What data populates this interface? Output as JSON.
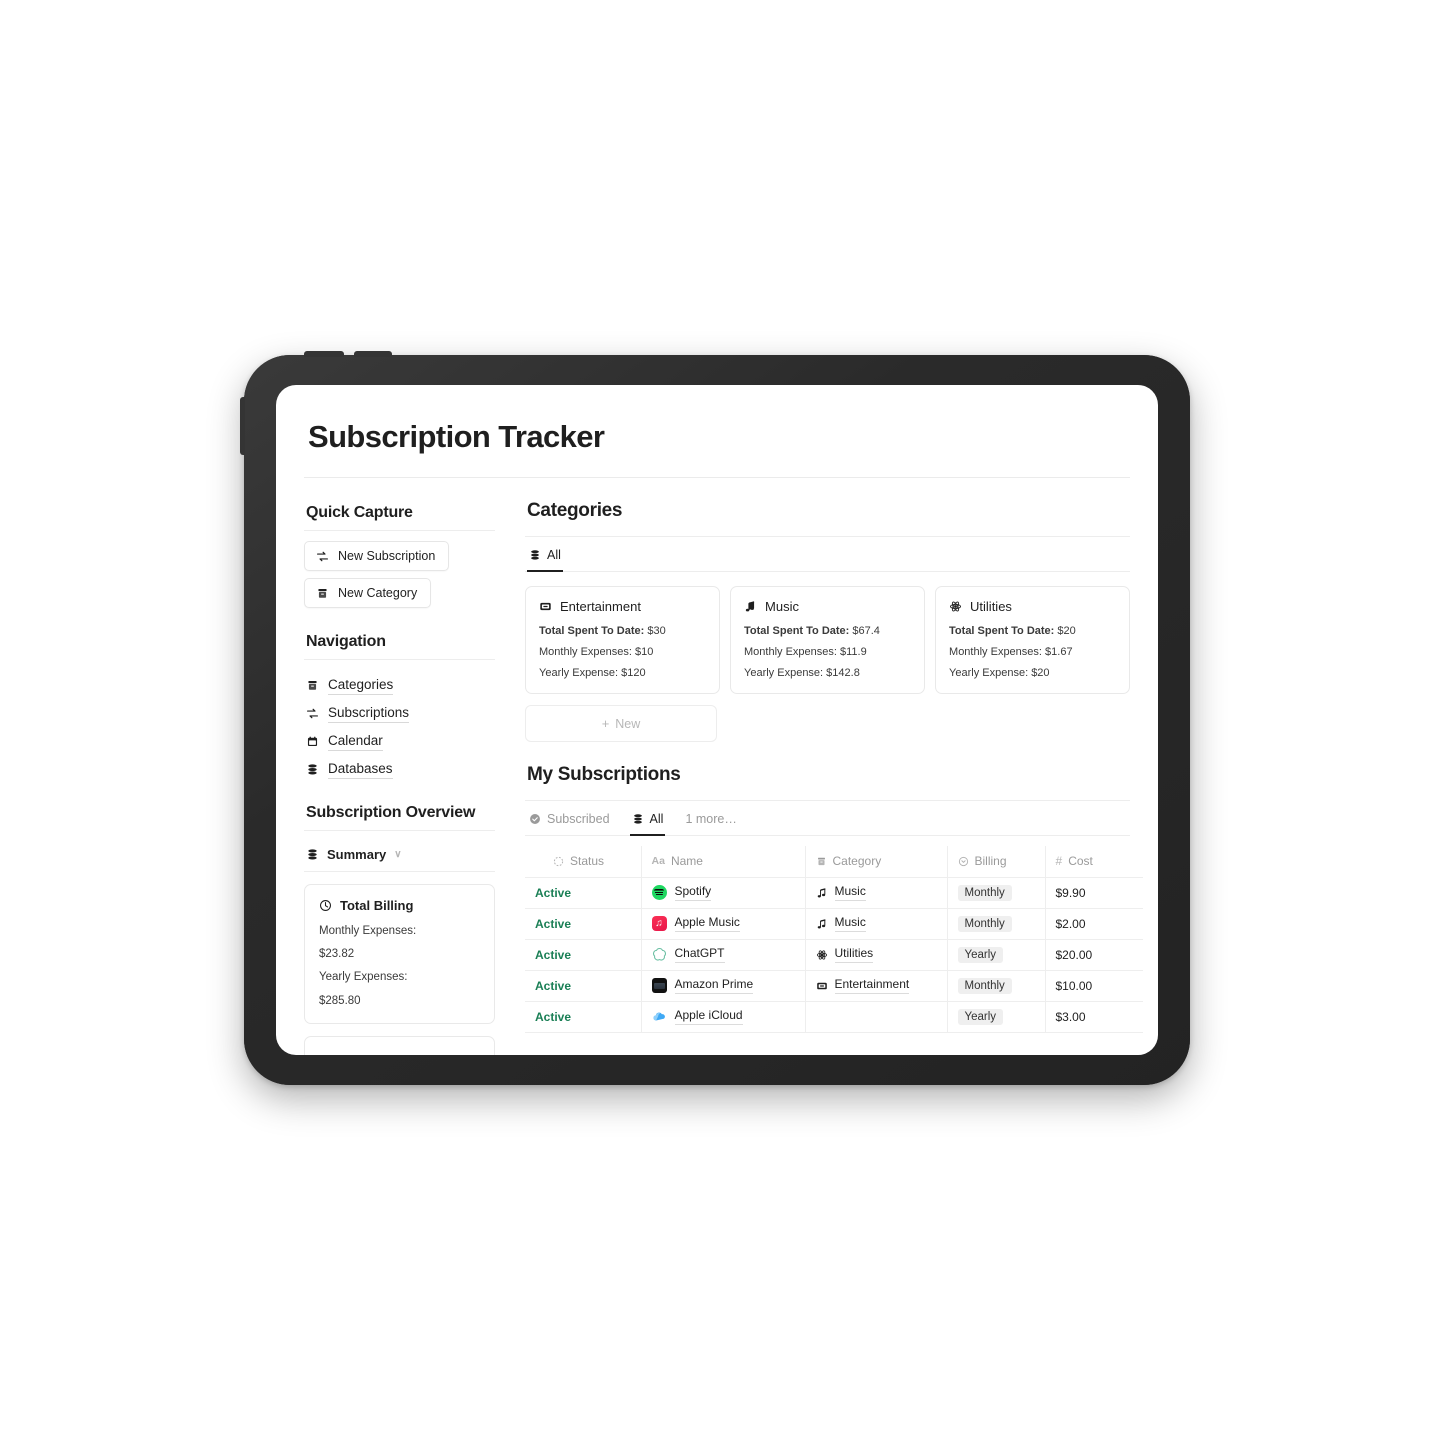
{
  "page": {
    "title": "Subscription Tracker"
  },
  "sidebar": {
    "quick_capture": {
      "heading": "Quick Capture",
      "buttons": [
        {
          "label": "New Subscription",
          "icon": "sync-icon"
        },
        {
          "label": "New Category",
          "icon": "archive-icon"
        }
      ]
    },
    "navigation": {
      "heading": "Navigation",
      "items": [
        {
          "label": "Categories",
          "icon": "archive-icon"
        },
        {
          "label": "Subscriptions",
          "icon": "sync-icon"
        },
        {
          "label": "Calendar",
          "icon": "calendar-icon"
        },
        {
          "label": "Databases",
          "icon": "database-icon"
        }
      ]
    },
    "overview": {
      "heading": "Subscription Overview",
      "view_label": "Summary",
      "view_icon": "database-icon",
      "chevron": "∨",
      "card": {
        "title": "Total Billing",
        "icon": "clock-icon",
        "lines": [
          "Monthly Expenses:",
          "$23.82",
          "Yearly Expenses:",
          "$285.80"
        ]
      }
    }
  },
  "categories_section": {
    "heading": "Categories",
    "tabs": [
      {
        "label": "All",
        "icon": "database-icon",
        "active": true
      }
    ],
    "cards": [
      {
        "name": "Entertainment",
        "icon": "tv-icon",
        "total_label": "Total Spent To Date:",
        "total_value": "$30",
        "monthly_label": "Monthly Expenses:",
        "monthly_value": "$10",
        "yearly_label": "Yearly Expense:",
        "yearly_value": "$120"
      },
      {
        "name": "Music",
        "icon": "music-note-icon",
        "total_label": "Total Spent To Date:",
        "total_value": "$67.4",
        "monthly_label": "Monthly Expenses:",
        "monthly_value": "$11.9",
        "yearly_label": "Yearly Expense:",
        "yearly_value": "$142.8"
      },
      {
        "name": "Utilities",
        "icon": "atom-icon",
        "total_label": "Total Spent To Date:",
        "total_value": "$20",
        "monthly_label": "Monthly Expenses:",
        "monthly_value": "$1.67",
        "yearly_label": "Yearly Expense:",
        "yearly_value": "$20"
      }
    ],
    "new_button": {
      "label": "New",
      "plus": "+"
    }
  },
  "subscriptions_section": {
    "heading": "My Subscriptions",
    "tabs": [
      {
        "label": "Subscribed",
        "icon": "check-circle-icon",
        "active": false
      },
      {
        "label": "All",
        "icon": "database-icon",
        "active": true
      },
      {
        "label": "1 more…",
        "icon": "",
        "active": false
      }
    ],
    "columns": [
      {
        "label": "Status",
        "icon": "dashed-circle-icon"
      },
      {
        "label": "Name",
        "icon": "aa-text-icon"
      },
      {
        "label": "Category",
        "icon": "archive-icon"
      },
      {
        "label": "Billing",
        "icon": "select-circle-icon"
      },
      {
        "label": "Cost",
        "icon": "hash-icon"
      }
    ],
    "rows": [
      {
        "status": "Active",
        "name": "Spotify",
        "logo": "spotify-logo",
        "category": "Music",
        "category_icon": "music-note-icon",
        "billing": "Monthly",
        "cost": "$9.90"
      },
      {
        "status": "Active",
        "name": "Apple Music",
        "logo": "apple-music-logo",
        "category": "Music",
        "category_icon": "music-note-icon",
        "billing": "Monthly",
        "cost": "$2.00"
      },
      {
        "status": "Active",
        "name": "ChatGPT",
        "logo": "chatgpt-logo",
        "category": "Utilities",
        "category_icon": "atom-icon",
        "billing": "Yearly",
        "cost": "$20.00"
      },
      {
        "status": "Active",
        "name": "Amazon Prime",
        "logo": "amazon-logo",
        "category": "Entertainment",
        "category_icon": "tv-icon",
        "billing": "Monthly",
        "cost": "$10.00"
      },
      {
        "status": "Active",
        "name": "Apple iCloud",
        "logo": "icloud-logo",
        "category": "",
        "category_icon": "",
        "billing": "Yearly",
        "cost": "$3.00"
      }
    ]
  },
  "colors": {
    "accent_active": "#1a7f55",
    "frame": "#2b2b2b",
    "pill_bg": "#efefef"
  }
}
